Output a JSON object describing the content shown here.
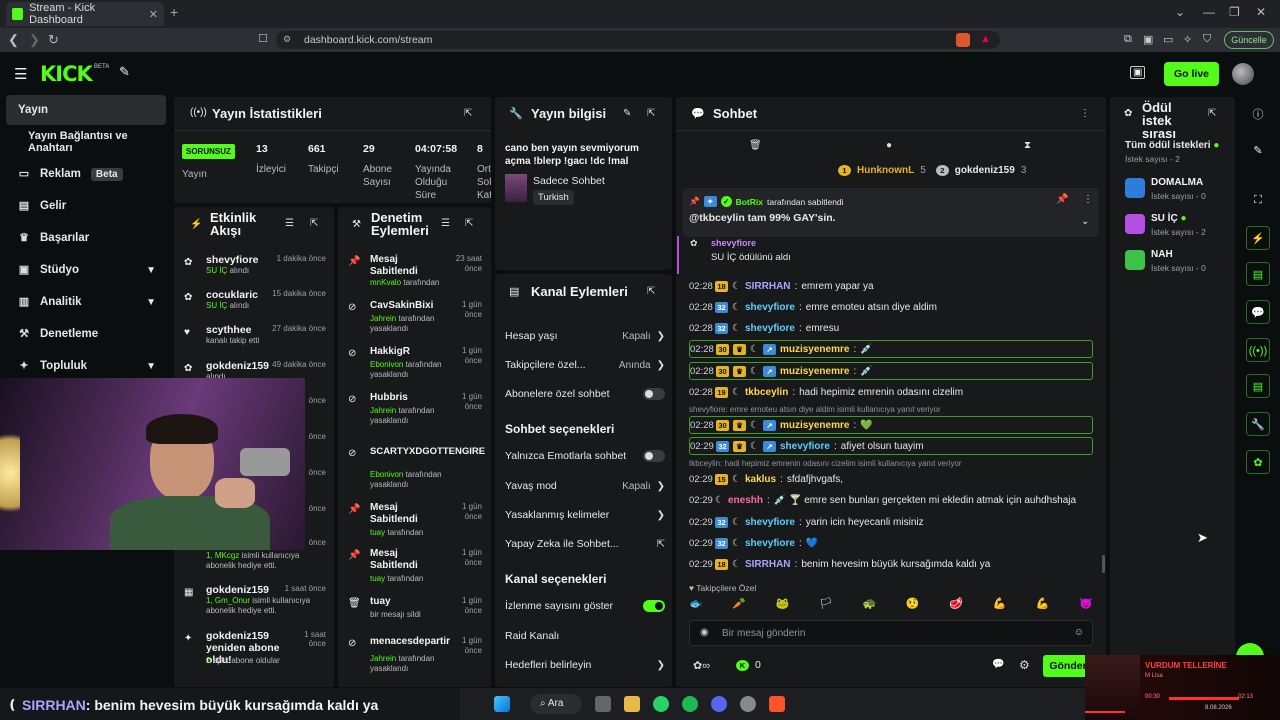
{
  "browser": {
    "tab_title": "Stream - Kick Dashboard",
    "url": "dashboard.kick.com/stream",
    "update_label": "Güncelle"
  },
  "header": {
    "logo": "KICK",
    "logo_badge": "BETA",
    "go_live": "Go live"
  },
  "sidebar": {
    "items": [
      {
        "label": "Yayın",
        "icon": "broadcast-icon",
        "active": true
      },
      {
        "label": "Yayın Bağlantısı ve Anahtarı"
      },
      {
        "label": "Reklam",
        "badge": "Beta",
        "icon": "ad-icon"
      },
      {
        "label": "Gelir",
        "icon": "revenue-icon"
      },
      {
        "label": "Başarılar",
        "icon": "trophy-icon"
      },
      {
        "label": "Stüdyo",
        "icon": "studio-icon"
      },
      {
        "label": "Analitik",
        "icon": "analytics-icon"
      },
      {
        "label": "Denetleme",
        "icon": "moderation-icon"
      },
      {
        "label": "Topluluk",
        "icon": "community-icon"
      }
    ]
  },
  "stats": {
    "title": "Yayın İstatistikleri",
    "status_badge": "SORUNSUZ",
    "status_label": "Yayın",
    "viewers": "13",
    "viewers_label": "İzleyici",
    "followers": "661",
    "followers_label": "Takipçi",
    "subs": "29",
    "subs_label": "Abone Sayısı",
    "duration": "04:07:58",
    "duration_label": "Yayında Olduğu Süre",
    "extra": "8",
    "extra_label": "Ort Sol Kat"
  },
  "activity": {
    "title": "Etkinlik Akışı",
    "items": [
      {
        "name": "shevyfiore",
        "sub_hl": "SU İÇ",
        "sub": " alındı",
        "time": "1 dakika önce"
      },
      {
        "name": "cocuklaric",
        "sub_hl": "SU İÇ",
        "sub": " alındı",
        "time": "15 dakika önce"
      },
      {
        "name": "scythhee",
        "sub": "kanalı takip etti",
        "time": "27 dakika önce"
      },
      {
        "name": "gokdeniz159",
        "sub": "alındı",
        "time": "49 dakika önce"
      },
      {
        "name": "",
        "sub": "",
        "time": "önce"
      },
      {
        "name": "",
        "sub": "",
        "time": "önce"
      },
      {
        "name": "",
        "sub": "",
        "time": "önce"
      },
      {
        "name": "",
        "sub": "",
        "time": "önce"
      },
      {
        "name": "",
        "sub_hl": "1, MKcgz",
        "sub": " isimli kullanıcıya abonelik hediye etti.",
        "time": "önce"
      },
      {
        "name": "gokdeniz159",
        "sub_hl": "1, Gm_Onur",
        "sub": " isimli kullanıcıya abonelik hediye etti.",
        "time": "1 saat önce"
      },
      {
        "name": "gokdeniz159 yeniden abone oldu!",
        "sub_hl": "2",
        "sub": " aylık abone oldular",
        "time": "1 saat önce"
      }
    ]
  },
  "moderation": {
    "title": "Denetim Eylemleri",
    "items": [
      {
        "name": "Mesaj Sabitlendi",
        "by": "mnKvalo",
        "suffix": " tarafından",
        "time": "23 saat önce"
      },
      {
        "name": "CavSakinBixi",
        "by": "Jahrein",
        "suffix": " tarafından yasaklandı",
        "time": "1 gün önce"
      },
      {
        "name": "HakkigR",
        "by": "Ebonivon",
        "suffix": " tarafından yasaklandı",
        "time": "1 gün önce"
      },
      {
        "name": "Hubbris",
        "by": "Jahrein",
        "suffix": " tarafından yasaklandı",
        "time": "1 gün önce"
      },
      {
        "name": "SCARTYXDGOTTENGIRE",
        "by": "Ebonivon",
        "suffix": " tarafından yasaklandı",
        "time": ""
      },
      {
        "name": "Mesaj Sabitlendi",
        "by": "tuay",
        "suffix": " tarafından",
        "time": "1 gün önce"
      },
      {
        "name": "Mesaj Sabitlendi",
        "by": "tuay",
        "suffix": " tarafından",
        "time": "1 gün önce"
      },
      {
        "name": "tuay",
        "by": "",
        "suffix": "bir mesajı sildi",
        "time": "1 gün önce"
      },
      {
        "name": "menacesdepartir",
        "by": "Jahrein",
        "suffix": " tarafından yasaklandı",
        "time": "1 gün önce"
      }
    ]
  },
  "stream_info": {
    "title": "Yayın bilgisi",
    "stream_title": "cano ben yayın sevmiyorum açma !blerp !gacı !dc !mal",
    "category": "Sadece Sohbet",
    "language": "Turkish"
  },
  "channel_actions": {
    "title": "Kanal Eylemleri",
    "rows1": [
      {
        "label": "Hesap yaşı",
        "value": "Kapalı",
        "kind": "arrow"
      },
      {
        "label": "Takipçilere özel...",
        "value": "Anında",
        "kind": "arrow",
        "green": true
      },
      {
        "label": "Abonelere özel sohbet",
        "kind": "toggle"
      }
    ],
    "section1": "Sohbet seçenekleri",
    "rows2": [
      {
        "label": "Yalnızca Emotlarla sohbet",
        "kind": "toggle"
      },
      {
        "label": "Yavaş mod",
        "value": "Kapalı",
        "kind": "arrow"
      },
      {
        "label": "Yasaklanmış kelimeler",
        "kind": "arrow"
      },
      {
        "label": "Yapay Zeka ile Sohbet...",
        "kind": "ext"
      }
    ],
    "section2": "Kanal seçenekleri",
    "rows3": [
      {
        "label": "İzlenme sayısını göster",
        "kind": "toggle",
        "on": true
      },
      {
        "label": "Raid Kanalı",
        "kind": "none"
      },
      {
        "label": "Hedefleri belirleyin",
        "kind": "arrow"
      }
    ]
  },
  "chat": {
    "title": "Sohbet",
    "top_gifters": [
      {
        "rank": "1",
        "name": "HunknownL",
        "count": "5"
      },
      {
        "rank": "2",
        "name": "gokdeniz159",
        "count": "3"
      }
    ],
    "pinned": {
      "by_name": "BotRix",
      "by_suffix": "tarafından sabitlendi",
      "text": "@tkbceylin tam 99% GAY'sin."
    },
    "redeem": {
      "user": "shevyfiore",
      "text": "SU İÇ ödülünü aldı"
    },
    "messages": [
      {
        "time": "02:28",
        "badge": "18",
        "bc": "y",
        "user": "SIRRHAN",
        "color": "#a8a6ff",
        "text": "emrem yapar ya"
      },
      {
        "time": "02:28",
        "badge": "32",
        "bc": "b",
        "user": "shevyfiore",
        "color": "#5bd0ff",
        "text": "emre emoteu atsın diye aldim"
      },
      {
        "time": "02:28",
        "badge": "32",
        "bc": "b",
        "user": "shevyfiore",
        "color": "#5bd0ff",
        "text": "emresu"
      },
      {
        "time": "02:28",
        "badge": "30",
        "bc": "y",
        "user": "muzisyenemre",
        "color": "#ffd84d",
        "text": "💉",
        "hl": true
      },
      {
        "time": "02:28",
        "badge": "30",
        "bc": "y",
        "user": "muzisyenemre",
        "color": "#ffd84d",
        "text": "💉",
        "hl": true
      },
      {
        "time": "02:28",
        "badge": "19",
        "bc": "y",
        "user": "tkbceylin",
        "color": "#ffd84d",
        "text": "hadi hepimiz emrenin odasını cizelim"
      },
      {
        "reply": "shevyfiore: emre emoteu atsın diye aldim isimli kullanıcıya yanıt veriyor"
      },
      {
        "time": "02:28",
        "badge": "30",
        "bc": "y",
        "user": "muzisyenemre",
        "color": "#ffd84d",
        "text": "💚",
        "hl": true
      },
      {
        "time": "02:29",
        "badge": "32",
        "bc": "b",
        "user": "shevyfiore",
        "color": "#5bd0ff",
        "text": "afiyet olsun tuayim",
        "hl": true
      },
      {
        "reply": "tkbceylin: hadi hepimiz emrenin odasını cizelim isimli kullanıcıya yanıt veriyor"
      },
      {
        "time": "02:29",
        "badge": "15",
        "bc": "y",
        "user": "kaklus",
        "color": "#ffd84d",
        "text": "sfdafjhvgafs,"
      },
      {
        "time": "02:29",
        "badge": "",
        "bc": "",
        "user": "eneshh",
        "color": "#ff6b9a",
        "text": "💉 🍸     emre sen bunları gerçekten mi ekledin atmak için auhdhshaja"
      },
      {
        "time": "02:29",
        "badge": "32",
        "bc": "b",
        "user": "shevyfiore",
        "color": "#5bd0ff",
        "text": "yarin icin heyecanli misiniz"
      },
      {
        "time": "02:29",
        "badge": "32",
        "bc": "b",
        "user": "shevyfiore",
        "color": "#5bd0ff",
        "text": "💙"
      },
      {
        "time": "02:29",
        "badge": "18",
        "bc": "y",
        "user": "SIRRHAN",
        "color": "#a8a6ff",
        "text": "benim hevesim büyük kursağımda kaldı ya"
      }
    ],
    "followers_only": "Takipçilere Özel",
    "input_placeholder": "Bir mesaj gönderin",
    "points": "0",
    "send": "Gönder"
  },
  "requests": {
    "title": "Ödül istek sırası",
    "all": "Tüm ödül istekleri",
    "all_count": "İstek sayısı - 2",
    "items": [
      {
        "name": "DOMALMA",
        "count": "İstek sayısı - 0",
        "color": "#2f7ddb"
      },
      {
        "name": "SU İÇ",
        "count": "İstek sayısı - 2",
        "color": "#b44fe6"
      },
      {
        "name": "NAH",
        "count": "İstek sayısı - 0",
        "color": "#3dc24a"
      }
    ]
  },
  "overlay": {
    "caption_user": "SIRRHAN",
    "caption_text": ": benim hevesim büyük kursağımda kaldı ya",
    "search": "Ara",
    "song": "VURDUM TELLERİNE",
    "artist": "M Lisa",
    "elapsed": "00:30",
    "total": "02:13",
    "date": "8.08.2026"
  }
}
